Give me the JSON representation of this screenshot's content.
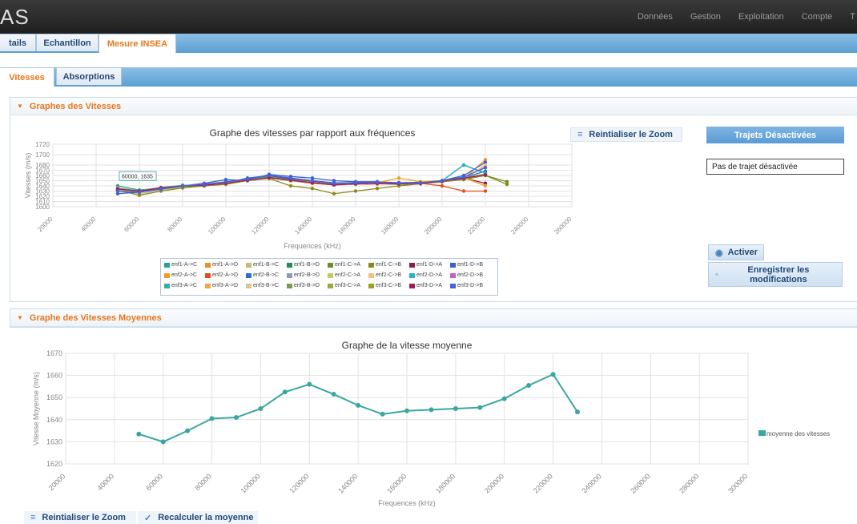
{
  "app": {
    "logo": "AS"
  },
  "topnav": [
    "Données",
    "Gestion",
    "Exploitation",
    "Compte",
    "T"
  ],
  "tabs1": [
    {
      "label": "tails",
      "active": false
    },
    {
      "label": "Echantillon",
      "active": false
    },
    {
      "label": "Mesure INSEA",
      "active": true
    }
  ],
  "tabs2": [
    {
      "label": "Vitesses",
      "active": true
    },
    {
      "label": "Absorptions",
      "active": false
    }
  ],
  "section1": {
    "title": "Graphes des Vitesses",
    "reset_zoom": "Reintialiser le Zoom",
    "trajets_header": "Trajets Désactivées",
    "trajets_empty": "Pas de trajet désactivée",
    "activer": "Activer",
    "enregistrer": "Enregistrer les modifications"
  },
  "section2": {
    "title": "Graphe des Vitesses Moyennes",
    "reset_zoom": "Reintialiser le Zoom",
    "recalc": "Recalculer la moyenne"
  },
  "chart_data": [
    {
      "type": "line",
      "title": "Graphe des vitesses par rapport aux fréquences",
      "xlabel": "Frequences (kHz)",
      "ylabel": "Vitesses (m/s)",
      "ylim": [
        1600,
        1720
      ],
      "xlim": [
        20000,
        260000
      ],
      "yticks": [
        1600,
        1610,
        1620,
        1630,
        1640,
        1650,
        1660,
        1670,
        1680,
        1700,
        1720
      ],
      "xticks": [
        "20000",
        "40000",
        "60000",
        "80000",
        "100000",
        "120000",
        "140000",
        "160000",
        "180000",
        "200000",
        "220000",
        "240000",
        "260000"
      ],
      "tooltip": "60000, 1635",
      "x": [
        50000,
        60000,
        70000,
        80000,
        90000,
        100000,
        110000,
        120000,
        130000,
        140000,
        150000,
        160000,
        170000,
        180000,
        190000,
        200000,
        210000,
        220000,
        230000
      ],
      "series": [
        {
          "name": "enf1-A->C",
          "color": "#2a9d9d",
          "values": [
            1640,
            1632,
            1636,
            1640,
            1644,
            1646,
            1650,
            1658,
            1654,
            1648,
            1643,
            1644,
            1646,
            1645,
            1645,
            1650,
            1656,
            1662,
            null
          ]
        },
        {
          "name": "enf1-A->D",
          "color": "#f28c1f",
          "values": [
            1632,
            1628,
            1634,
            1640,
            1641,
            1645,
            1652,
            1655,
            1650,
            1646,
            1642,
            1644,
            1645,
            1644,
            1646,
            1648,
            1654,
            1690,
            null
          ]
        },
        {
          "name": "enf1-B->C",
          "color": "#c8b87a",
          "values": [
            1630,
            1625,
            1632,
            1638,
            1640,
            1644,
            1651,
            1656,
            1652,
            1647,
            1643,
            1643,
            1644,
            1644,
            1645,
            1649,
            1655,
            1678,
            null
          ]
        },
        {
          "name": "enf1-B->D",
          "color": "#1f8a5a",
          "values": [
            1636,
            1630,
            1636,
            1641,
            1642,
            1646,
            1652,
            1657,
            1652,
            1647,
            1643,
            1645,
            1645,
            1645,
            1646,
            1650,
            1680,
            1665,
            null
          ]
        },
        {
          "name": "enf1-C->A",
          "color": "#6b8e23",
          "values": [
            1634,
            1628,
            1634,
            1639,
            1640,
            1644,
            1650,
            1655,
            1650,
            1646,
            1642,
            1643,
            1644,
            1643,
            1644,
            1648,
            1654,
            1660,
            1648
          ]
        },
        {
          "name": "enf1-C->B",
          "color": "#8a8a1a",
          "values": [
            1632,
            1622,
            1630,
            1636,
            1640,
            1643,
            1650,
            1654,
            1640,
            1635,
            1625,
            1630,
            1635,
            1640,
            1644,
            1648,
            1652,
            1660,
            1643
          ]
        },
        {
          "name": "enf1-D->A",
          "color": "#8b1a4a",
          "values": [
            1635,
            1630,
            1636,
            1640,
            1642,
            1646,
            1652,
            1660,
            1653,
            1648,
            1644,
            1645,
            1646,
            1646,
            1646,
            1650,
            1655,
            1645,
            null
          ]
        },
        {
          "name": "enf1-D->B",
          "color": "#3a5fd0",
          "values": [
            1625,
            1628,
            1634,
            1640,
            1645,
            1652,
            1650,
            1662,
            1658,
            1655,
            1650,
            1648,
            1648,
            1646,
            1647,
            1650,
            1660,
            1685,
            null
          ]
        },
        {
          "name": "enf2-A->C",
          "color": "#f0a020",
          "values": [
            1633,
            1630,
            1636,
            1641,
            1642,
            1646,
            1652,
            1656,
            1651,
            1646,
            1642,
            1644,
            1646,
            1655,
            1648,
            1650,
            1656,
            1640,
            null
          ]
        },
        {
          "name": "enf2-A->D",
          "color": "#e84a1a",
          "values": [
            1631,
            1629,
            1635,
            1640,
            1641,
            1645,
            1651,
            1655,
            1650,
            1645,
            1642,
            1643,
            1644,
            1644,
            1645,
            1640,
            1630,
            1630,
            null
          ]
        },
        {
          "name": "enf2-B->C",
          "color": "#2a6fd0",
          "values": [
            1630,
            1629,
            1635,
            1640,
            1642,
            1646,
            1655,
            1660,
            1655,
            1650,
            1646,
            1646,
            1646,
            1645,
            1646,
            1650,
            1656,
            1668,
            null
          ]
        },
        {
          "name": "enf2-B->D",
          "color": "#8aa0b0",
          "values": [
            1634,
            1630,
            1636,
            1640,
            1641,
            1645,
            1651,
            1655,
            1651,
            1646,
            1642,
            1644,
            1645,
            1644,
            1645,
            1649,
            1655,
            1662,
            null
          ]
        },
        {
          "name": "enf2-C->A",
          "color": "#c8c860",
          "values": [
            1636,
            1631,
            1637,
            1641,
            1642,
            1646,
            1652,
            1657,
            1652,
            1647,
            1643,
            1645,
            1646,
            1645,
            1646,
            1650,
            1656,
            1663,
            null
          ]
        },
        {
          "name": "enf2-C->B",
          "color": "#f4c080",
          "values": [
            1634,
            1630,
            1636,
            1640,
            1641,
            1645,
            1651,
            1656,
            1651,
            1646,
            1642,
            1644,
            1645,
            1644,
            1645,
            1649,
            1655,
            1680,
            null
          ]
        },
        {
          "name": "enf2-D->A",
          "color": "#2ab0d0",
          "values": [
            1633,
            1630,
            1636,
            1640,
            1641,
            1645,
            1651,
            1656,
            1651,
            1646,
            1642,
            1644,
            1645,
            1644,
            1645,
            1650,
            1680,
            1664,
            null
          ]
        },
        {
          "name": "enf2-D->B",
          "color": "#c060c0",
          "values": [
            1632,
            1630,
            1636,
            1640,
            1641,
            1645,
            1651,
            1655,
            1650,
            1646,
            1642,
            1644,
            1645,
            1644,
            1645,
            1649,
            1655,
            1660,
            null
          ]
        },
        {
          "name": "enf3-A->C",
          "color": "#30b0a0",
          "values": [
            1635,
            1631,
            1637,
            1641,
            1642,
            1646,
            1652,
            1657,
            1652,
            1647,
            1643,
            1645,
            1646,
            1645,
            1646,
            1650,
            1656,
            1662,
            null
          ]
        },
        {
          "name": "enf3-A->D",
          "color": "#f4a840",
          "values": [
            1633,
            1630,
            1636,
            1640,
            1641,
            1645,
            1651,
            1656,
            1651,
            1646,
            1642,
            1644,
            1645,
            1644,
            1645,
            1649,
            1655,
            1661,
            null
          ]
        },
        {
          "name": "enf3-B->C",
          "color": "#d8c890",
          "values": [
            1632,
            1629,
            1635,
            1640,
            1641,
            1645,
            1651,
            1655,
            1650,
            1646,
            1642,
            1643,
            1645,
            1644,
            1645,
            1649,
            1655,
            1661,
            null
          ]
        },
        {
          "name": "enf3-B->D",
          "color": "#7a9a50",
          "values": [
            1634,
            1630,
            1636,
            1640,
            1641,
            1645,
            1651,
            1656,
            1651,
            1646,
            1642,
            1644,
            1645,
            1644,
            1645,
            1649,
            1655,
            1661,
            null
          ]
        },
        {
          "name": "enf3-C->A",
          "color": "#9aaa40",
          "values": [
            1635,
            1630,
            1636,
            1640,
            1642,
            1646,
            1652,
            1656,
            1651,
            1647,
            1642,
            1644,
            1645,
            1645,
            1645,
            1650,
            1655,
            1662,
            null
          ]
        },
        {
          "name": "enf3-C->B",
          "color": "#a0a020",
          "values": [
            1633,
            1630,
            1636,
            1640,
            1641,
            1645,
            1651,
            1655,
            1650,
            1646,
            1642,
            1644,
            1645,
            1644,
            1645,
            1649,
            1655,
            1660,
            null
          ]
        },
        {
          "name": "enf3-D->A",
          "color": "#a01a60",
          "values": [
            1634,
            1630,
            1636,
            1640,
            1641,
            1645,
            1651,
            1656,
            1651,
            1646,
            1642,
            1644,
            1645,
            1644,
            1645,
            1649,
            1655,
            1661,
            null
          ]
        },
        {
          "name": "enf3-D->B",
          "color": "#4a60e0",
          "values": [
            1630,
            1628,
            1634,
            1640,
            1643,
            1648,
            1653,
            1660,
            1655,
            1650,
            1645,
            1646,
            1647,
            1646,
            1646,
            1650,
            1657,
            1675,
            null
          ]
        }
      ]
    },
    {
      "type": "line",
      "title": "Graphe de la vitesse moyenne",
      "xlabel": "Frequences (kHz)",
      "ylabel": "Vitesse Moyenne (m/s)",
      "ylim": [
        1620,
        1670
      ],
      "xlim": [
        20000,
        300000
      ],
      "yticks": [
        1620,
        1630,
        1640,
        1650,
        1660,
        1670
      ],
      "xticks": [
        "20000",
        "40000",
        "60000",
        "80000",
        "100000",
        "120000",
        "140000",
        "160000",
        "180000",
        "200000",
        "220000",
        "240000",
        "260000",
        "280000",
        "300000"
      ],
      "x": [
        50000,
        60000,
        70000,
        80000,
        90000,
        100000,
        110000,
        120000,
        130000,
        140000,
        150000,
        160000,
        170000,
        180000,
        190000,
        200000,
        210000,
        220000,
        230000
      ],
      "series": [
        {
          "name": "moyenne des vitesses",
          "color": "#3aa6a0",
          "values": [
            1633.5,
            1630,
            1635,
            1640.5,
            1641,
            1645,
            1652.5,
            1656,
            1651.5,
            1646.5,
            1642.5,
            1644,
            1644.5,
            1645,
            1645.5,
            1649.5,
            1655.5,
            1660.5,
            1643.5
          ]
        }
      ]
    }
  ]
}
